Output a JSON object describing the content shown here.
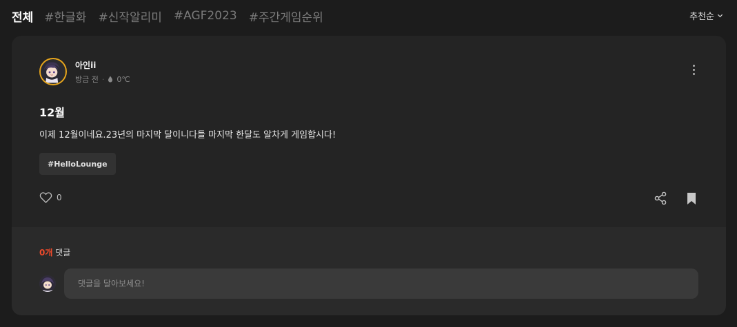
{
  "tabs": [
    {
      "label": "전체",
      "active": true
    },
    {
      "label": "#한글화",
      "active": false
    },
    {
      "label": "#신작알리미",
      "active": false
    },
    {
      "label": "#AGF2023",
      "active": false
    },
    {
      "label": "#주간게임순위",
      "active": false
    }
  ],
  "sort": {
    "label": "추천순",
    "icon": "chevron-down-icon"
  },
  "post": {
    "author": "아인ii",
    "time": "방금 전",
    "temperature": "0℃",
    "title": "12월",
    "body": "이제 12월이네요.23년의 마지막 달이니다들 마지막 한달도 알차게 게임합시다!",
    "tag": "#HelloLounge",
    "likes": "0",
    "avatar_border_color": "#e7a51c"
  },
  "comments": {
    "count": "0개",
    "label": "댓글",
    "placeholder": "댓글을 달아보세요!"
  },
  "colors": {
    "accent": "#f04a2b",
    "background": "#1c1c1c",
    "card": "#242424"
  }
}
